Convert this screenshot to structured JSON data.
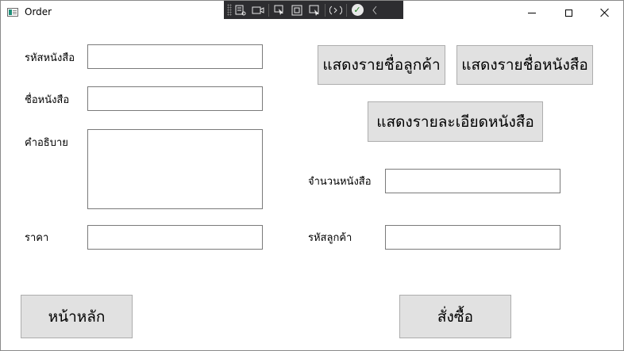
{
  "window": {
    "title": "Order"
  },
  "devtools": {
    "tools": [
      "live-visual-tree-icon",
      "camera-icon",
      "select-element-icon",
      "display-layout-adorners-icon",
      "track-focus-icon",
      "hot-reload-icon",
      "binding-check-icon",
      "collapse-icon"
    ]
  },
  "form": {
    "book_id_label": "รหัสหนังสือ",
    "book_name_label": "ชื่อหนังสือ",
    "description_label": "คำอธิบาย",
    "price_label": "ราคา",
    "quantity_label": "จำนวนหนังสือ",
    "customer_id_label": "รหัสลูกค้า",
    "book_id_value": "",
    "book_name_value": "",
    "description_value": "",
    "price_value": "",
    "quantity_value": "",
    "customer_id_value": ""
  },
  "buttons": {
    "show_customers": "แสดงรายชื่อลูกค้า",
    "show_books": "แสดงรายชื่อหนังสือ",
    "show_book_details": "แสดงรายละเอียดหนังสือ",
    "home": "หน้าหลัก",
    "order": "สั่งซื้อ"
  }
}
